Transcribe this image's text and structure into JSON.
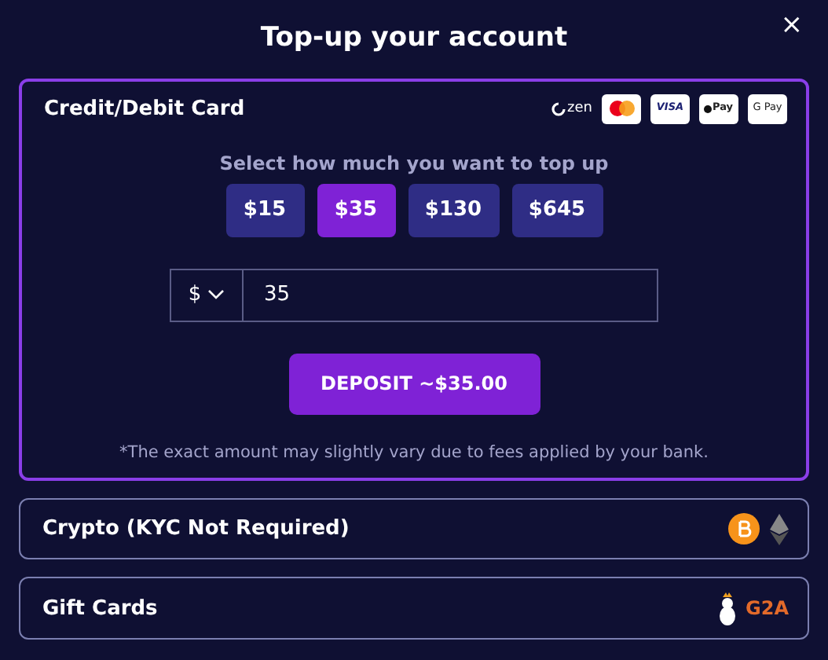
{
  "dialog": {
    "title": "Top-up your account",
    "close": "×"
  },
  "methods": [
    {
      "title": "Credit/Debit Card",
      "selected": true,
      "expanded": true,
      "logos": [
        {
          "kind": "zen",
          "text": "zen"
        },
        {
          "kind": "mastercard"
        },
        {
          "kind": "visa",
          "text": "VISA"
        },
        {
          "kind": "applepay",
          "text": "Pay"
        },
        {
          "kind": "googlepay",
          "text": "G Pay"
        }
      ],
      "prompt": "Select how much you want to top up",
      "amounts": [
        {
          "label": "$15",
          "selected": false
        },
        {
          "label": "$35",
          "selected": true
        },
        {
          "label": "$130",
          "selected": false
        },
        {
          "label": "$645",
          "selected": false
        }
      ],
      "currency": "$",
      "amount_value": "35",
      "deposit": "DEPOSIT ~$35.00",
      "note": "*The exact amount may slightly vary due to fees applied by your bank."
    },
    {
      "title": "Crypto (KYC Not Required)",
      "selected": false,
      "expanded": false,
      "logos": [
        {
          "kind": "bitcoin"
        },
        {
          "kind": "ethereum"
        }
      ]
    },
    {
      "title": "Gift Cards",
      "selected": false,
      "expanded": false,
      "logos": [
        {
          "kind": "mascot"
        },
        {
          "kind": "g2a",
          "text": "G2A"
        }
      ]
    }
  ]
}
